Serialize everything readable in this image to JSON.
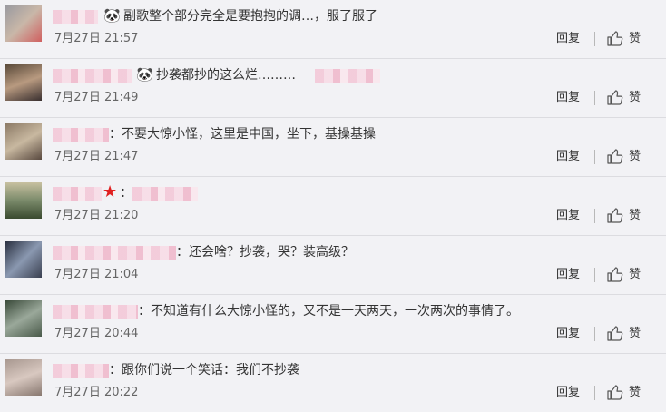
{
  "comments": [
    {
      "emoji": "🐼",
      "text": "副歌整个部分完全是要抱抱的调…，服了服了",
      "time": "7月27日 21:57",
      "reply": "回复",
      "like": "赞"
    },
    {
      "emoji": "🐼",
      "text": "抄袭都抄的这么烂………",
      "time": "7月27日 21:49",
      "reply": "回复",
      "like": "赞"
    },
    {
      "text": "：不要大惊小怪，这里是中国，坐下，基操基操",
      "time": "7月27日 21:47",
      "reply": "回复",
      "like": "赞"
    },
    {
      "star": "★",
      "text": "：",
      "time": "7月27日 21:20",
      "reply": "回复",
      "like": "赞"
    },
    {
      "text": "：还会啥？抄袭，哭？装高级？",
      "time": "7月27日 21:04",
      "reply": "回复",
      "like": "赞"
    },
    {
      "text": "：不知道有什么大惊小怪的，又不是一天两天，一次两次的事情了。",
      "time": "7月27日 20:44",
      "reply": "回复",
      "like": "赞"
    },
    {
      "text": "：跟你们说一个笑话：我们不抄袭",
      "time": "7月27日 20:22",
      "reply": "回复",
      "like": "赞"
    }
  ],
  "colors": {
    "background": "#f2f2f5",
    "text": "#333333",
    "meta": "#666666",
    "separator": "#dcdce0"
  }
}
